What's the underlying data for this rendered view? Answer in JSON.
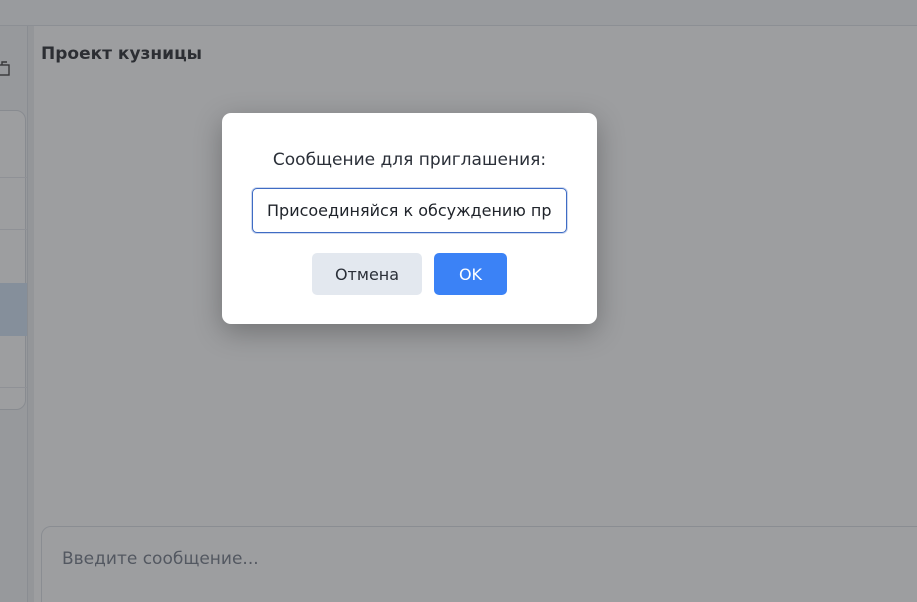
{
  "chat": {
    "title": "Проект кузницы",
    "composer_placeholder": "Введите сообщение..."
  },
  "dialog": {
    "message": "Сообщение для приглашения:",
    "input_value": "Присоединяйся к обсуждению про",
    "cancel_label": "Отмена",
    "ok_label": "OK"
  },
  "colors": {
    "accent": "#3b82f6",
    "overlay": "rgba(60,62,66,0.5)",
    "selected_row": "#cfe0f5"
  },
  "icons": {
    "sidebar_top": "new-chat-icon"
  }
}
